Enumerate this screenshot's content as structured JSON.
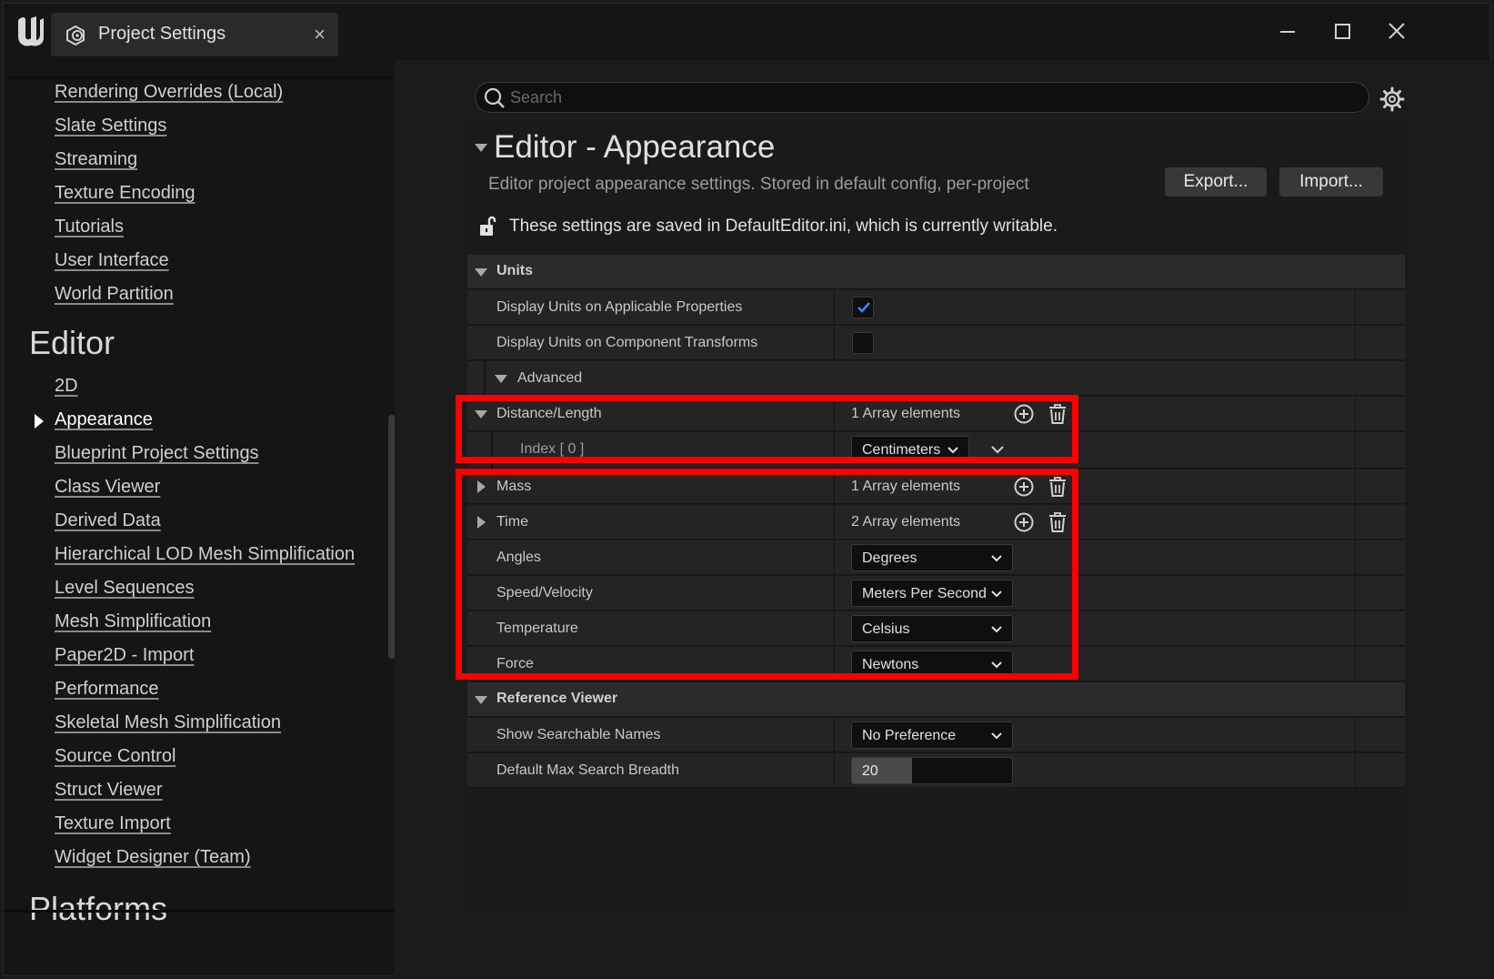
{
  "window": {
    "tab_title": "Project Settings",
    "tab_close": "×"
  },
  "sidebar": {
    "items_top": [
      "Rendering Overrides (Local)",
      "Slate Settings",
      "Streaming",
      "Texture Encoding",
      "Tutorials",
      "User Interface",
      "World Partition"
    ],
    "editor_heading": "Editor",
    "editor_items": [
      "2D",
      "Appearance",
      "Blueprint Project Settings",
      "Class Viewer",
      "Derived Data",
      "Hierarchical LOD Mesh Simplification",
      "Level Sequences",
      "Mesh Simplification",
      "Paper2D - Import",
      "Performance",
      "Skeletal Mesh Simplification",
      "Source Control",
      "Struct Viewer",
      "Texture Import",
      "Widget Designer (Team)"
    ],
    "selected_item": "Appearance",
    "platforms_heading": "Platforms"
  },
  "search": {
    "placeholder": "Search",
    "value": ""
  },
  "page": {
    "title": "Editor - Appearance",
    "description": "Editor project appearance settings. Stored in default config, per-project",
    "export_label": "Export...",
    "import_label": "Import...",
    "writable_note": "These settings are saved in DefaultEditor.ini, which is currently writable."
  },
  "units": {
    "category_label": "Units",
    "display_units_applicable": {
      "label": "Display Units on Applicable Properties",
      "checked": true
    },
    "display_units_transforms": {
      "label": "Display Units on Component Transforms",
      "checked": false
    },
    "advanced_label": "Advanced",
    "distance_length": {
      "label": "Distance/Length",
      "value": "1 Array elements"
    },
    "index0": {
      "label": "Index [ 0 ]",
      "value": "Centimeters"
    },
    "mass": {
      "label": "Mass",
      "value": "1 Array elements"
    },
    "time": {
      "label": "Time",
      "value": "2 Array elements"
    },
    "angles": {
      "label": "Angles",
      "value": "Degrees"
    },
    "speed": {
      "label": "Speed/Velocity",
      "value": "Meters Per Second"
    },
    "temperature": {
      "label": "Temperature",
      "value": "Celsius"
    },
    "force": {
      "label": "Force",
      "value": "Newtons"
    }
  },
  "reference_viewer": {
    "category_label": "Reference Viewer",
    "show_searchable_names": {
      "label": "Show Searchable Names",
      "value": "No Preference"
    },
    "default_max_search_breadth": {
      "label": "Default Max Search Breadth",
      "value": "20"
    }
  },
  "colors": {
    "highlight": "#ff0000",
    "checkbox_accent": "#2f8cf0",
    "background": "#151515"
  }
}
